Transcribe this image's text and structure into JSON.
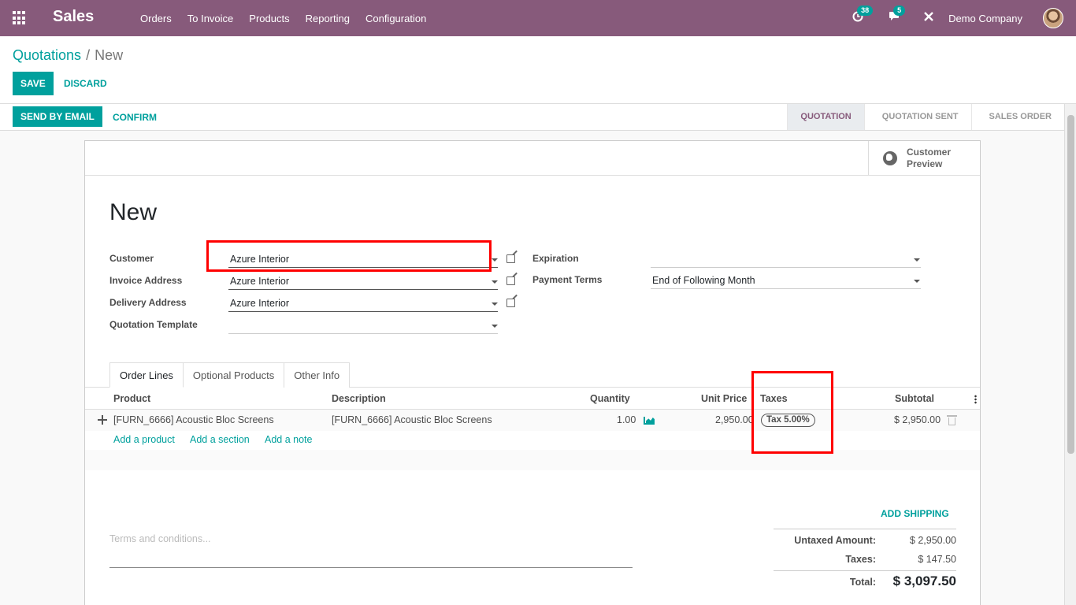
{
  "navbar": {
    "app_name": "Sales",
    "menu": [
      "Orders",
      "To Invoice",
      "Products",
      "Reporting",
      "Configuration"
    ],
    "activity_count": "38",
    "message_count": "5",
    "company": "Demo Company"
  },
  "breadcrumb": {
    "parent": "Quotations",
    "separator": "/",
    "current": "New"
  },
  "buttons": {
    "save": "SAVE",
    "discard": "DISCARD",
    "send_email": "SEND BY EMAIL",
    "confirm": "CONFIRM"
  },
  "stages": [
    "QUOTATION",
    "QUOTATION SENT",
    "SALES ORDER"
  ],
  "sheet": {
    "preview_label": "Customer Preview",
    "title": "New",
    "fields_left": [
      {
        "label": "Customer",
        "value": "Azure Interior"
      },
      {
        "label": "Invoice Address",
        "value": "Azure Interior"
      },
      {
        "label": "Delivery Address",
        "value": "Azure Interior"
      },
      {
        "label": "Quotation Template",
        "value": ""
      }
    ],
    "fields_right": [
      {
        "label": "Expiration",
        "value": ""
      },
      {
        "label": "Payment Terms",
        "value": "End of Following Month"
      }
    ]
  },
  "tabs": [
    "Order Lines",
    "Optional Products",
    "Other Info"
  ],
  "order_lines": {
    "columns": [
      "Product",
      "Description",
      "Quantity",
      "Unit Price",
      "Taxes",
      "Subtotal"
    ],
    "rows": [
      {
        "product": "[FURN_6666] Acoustic Bloc Screens",
        "description": "[FURN_6666] Acoustic Bloc Screens",
        "quantity": "1.00",
        "unit_price": "2,950.00",
        "tax": "Tax 5.00%",
        "subtotal": "$ 2,950.00"
      }
    ],
    "add_links": [
      "Add a product",
      "Add a section",
      "Add a note"
    ]
  },
  "footer": {
    "add_shipping": "ADD SHIPPING",
    "terms_placeholder": "Terms and conditions...",
    "untaxed_label": "Untaxed Amount:",
    "untaxed_value": "$ 2,950.00",
    "taxes_label": "Taxes:",
    "taxes_value": "$ 147.50",
    "total_label": "Total:",
    "total_value": "$ 3,097.50"
  },
  "colors": {
    "brand": "#875a7b",
    "accent": "#00a09d",
    "highlight": "#ff0000"
  },
  "icons": [
    "apps-grid-icon",
    "activity-clock-icon",
    "chat-icon",
    "tools-icon",
    "globe-icon",
    "external-link-icon",
    "dropdown-caret-icon",
    "drag-handle-icon",
    "forecast-chart-icon",
    "trash-icon",
    "kebab-menu-icon"
  ]
}
